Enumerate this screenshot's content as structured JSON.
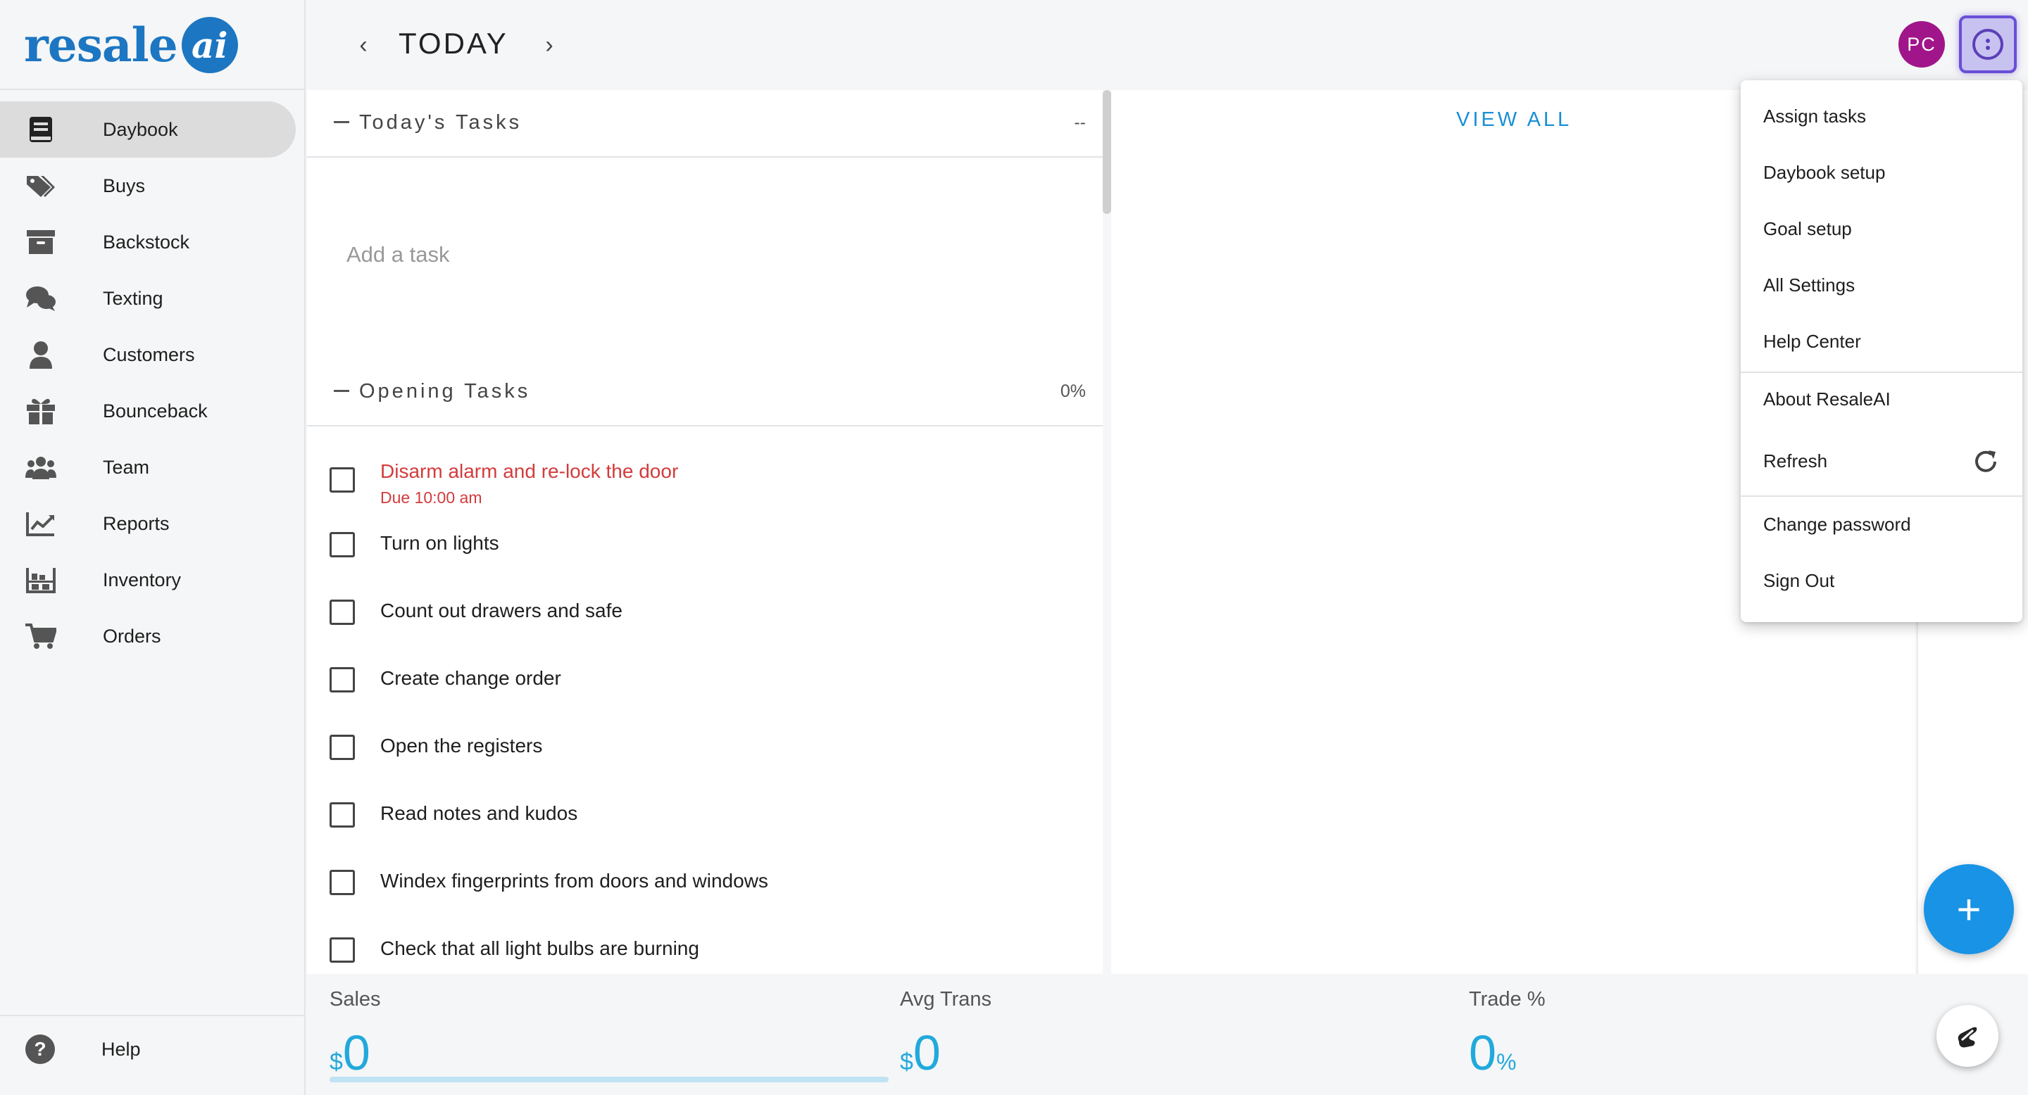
{
  "brand": {
    "logo_text": "resale",
    "logo_mark": "ai"
  },
  "sidebar": {
    "items": [
      {
        "label": "Daybook",
        "icon": "book-icon",
        "active": true
      },
      {
        "label": "Buys",
        "icon": "tags-icon"
      },
      {
        "label": "Backstock",
        "icon": "archive-box-icon"
      },
      {
        "label": "Texting",
        "icon": "chat-bubbles-icon"
      },
      {
        "label": "Customers",
        "icon": "person-icon"
      },
      {
        "label": "Bounceback",
        "icon": "gift-icon"
      },
      {
        "label": "Team",
        "icon": "group-icon"
      },
      {
        "label": "Reports",
        "icon": "chart-line-icon"
      },
      {
        "label": "Inventory",
        "icon": "warehouse-icon"
      },
      {
        "label": "Orders",
        "icon": "cart-icon"
      }
    ],
    "help": {
      "label": "Help",
      "icon_text": "?"
    }
  },
  "header": {
    "title": "TODAY",
    "prev_icon": "chevron-left-icon",
    "next_icon": "chevron-right-icon",
    "avatar_initials": "PC"
  },
  "todays_tasks": {
    "title": "Today's Tasks",
    "progress": "--",
    "add_placeholder": "Add a task"
  },
  "opening_tasks": {
    "title": "Opening Tasks",
    "progress": "0%",
    "items": [
      {
        "label": "Disarm alarm and re-lock the door",
        "due": "Due 10:00 am",
        "overdue": true
      },
      {
        "label": "Turn on lights"
      },
      {
        "label": "Count out drawers and safe"
      },
      {
        "label": "Create change order"
      },
      {
        "label": "Open the registers"
      },
      {
        "label": "Read notes and kudos"
      },
      {
        "label": "Windex fingerprints from doors and windows"
      },
      {
        "label": "Check that all light bulbs are burning"
      }
    ]
  },
  "right_panel": {
    "view_all": "VIEW ALL"
  },
  "menu": {
    "group1": [
      "Assign tasks",
      "Daybook setup",
      "Goal setup",
      "All Settings",
      "Help Center"
    ],
    "group2": [
      "About ResaleAI",
      "Refresh"
    ],
    "group3": [
      "Change password",
      "Sign Out"
    ]
  },
  "stats": {
    "sales": {
      "label": "Sales",
      "prefix": "$",
      "value": "0"
    },
    "avg_trans": {
      "label": "Avg Trans",
      "prefix": "$",
      "value": "0"
    },
    "trade": {
      "label": "Trade %",
      "value": "0",
      "suffix": "%"
    }
  },
  "fab": {
    "label": "+"
  },
  "colors": {
    "accent": "#1893e6",
    "brand": "#1c76c2",
    "avatar": "#a0168a",
    "overdue": "#d23c3c",
    "stat": "#22a9dc"
  }
}
